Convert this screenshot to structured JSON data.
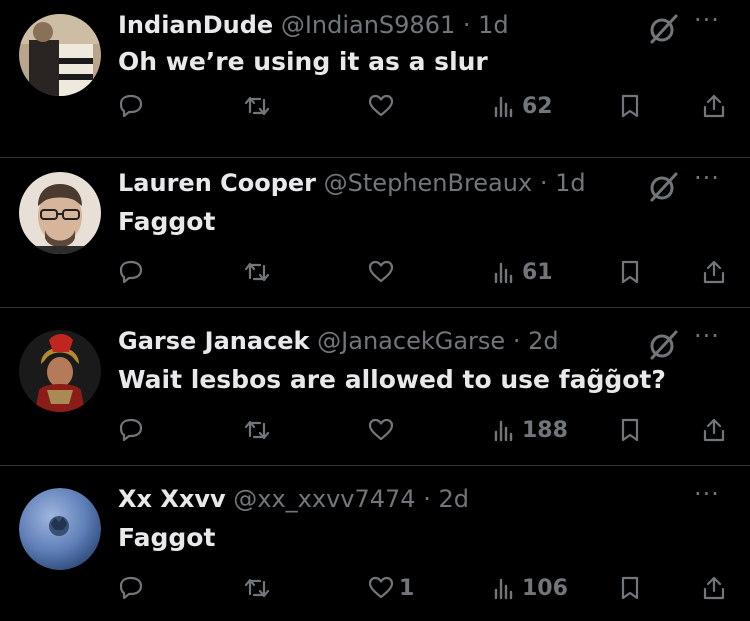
{
  "tweets": [
    {
      "name": "IndianDude",
      "handle": "@IndianS9861",
      "dot": "·",
      "time": "1d",
      "text": "Oh we’re using it as a slur",
      "likes": "",
      "views": "62",
      "more": "···",
      "avatar_icon": "avatar-photo",
      "show_grok": true
    },
    {
      "name": "Lauren Cooper",
      "handle": "@StephenBreaux",
      "dot": "·",
      "time": "1d",
      "text": "Faggot",
      "likes": "",
      "views": "61",
      "more": "···",
      "avatar_icon": "avatar-photo",
      "show_grok": true
    },
    {
      "name": "Garse Janacek",
      "handle": "@JanacekGarse",
      "dot": "·",
      "time": "2d",
      "text": "Wait lesbos are allowed to use fag̃g̃ot?",
      "likes": "",
      "views": "188",
      "more": "···",
      "avatar_icon": "avatar-photo",
      "show_grok": true
    },
    {
      "name": "Xx Xxvv",
      "handle": "@xx_xxvv7474",
      "dot": "·",
      "time": "2d",
      "text": "Faggot",
      "likes": "1",
      "views": "106",
      "more": "···",
      "avatar_icon": "avatar-photo",
      "show_grok": false
    }
  ],
  "colors": {
    "background": "#000000",
    "text": "#e7e9ea",
    "secondary": "#71767b",
    "divider": "#2f3336"
  },
  "icons": [
    "reply-icon",
    "retweet-icon",
    "like-icon",
    "views-icon",
    "bookmark-icon",
    "share-icon",
    "grok-icon",
    "more-icon"
  ]
}
